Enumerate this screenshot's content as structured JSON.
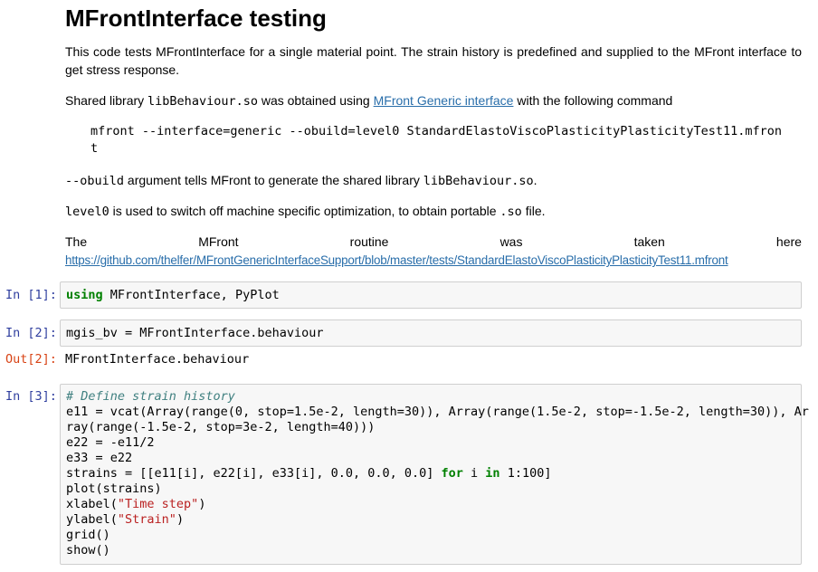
{
  "title": "MFrontInterface testing",
  "intro": {
    "p1": "This code tests MFrontInterface for a single material point. The strain history is predefined and supplied to the MFront interface to get stress response.",
    "p2_before": "Shared library ",
    "p2_code": "libBehaviour.so",
    "p2_mid": " was obtained using ",
    "p2_link": "MFront Generic interface",
    "p2_after": " with the following command",
    "command_line1": "mfront --interface=generic --obuild=level0 StandardElastoViscoPlasticityPlasticityTest11.mfron",
    "command_line2": "t",
    "p3_code": "--obuild",
    "p3_mid": " argument tells MFront to generate the shared library ",
    "p3_code2": "libBehaviour.so",
    "p3_after": ".",
    "p4_code": "level0",
    "p4_mid": " is used to switch off machine specific optimization, to obtain portable ",
    "p4_code2": ".so",
    "p4_after": " file.",
    "p5_words": [
      "The",
      "MFront",
      "routine",
      "was",
      "taken",
      "here"
    ],
    "p5_link": "https://github.com/thelfer/MFrontGenericInterfaceSupport/blob/master/tests/StandardElastoViscoPlasticityPlasticityTest11.mfront"
  },
  "cells": {
    "c1": {
      "prompt": "In [1]:",
      "kw": "using",
      "rest": " MFrontInterface, PyPlot"
    },
    "c2": {
      "prompt": "In [2]:",
      "code": "mgis_bv = MFrontInterface.behaviour",
      "out_prompt": "Out[2]:",
      "output": "MFrontInterface.behaviour"
    },
    "c3": {
      "prompt": "In [3]:",
      "comment": "# Define strain history",
      "l2": "e11 = vcat(Array(range(0, stop=1.5e-2, length=30)), Array(range(1.5e-2, stop=-1.5e-2, length=30)), Ar",
      "l3": "ray(range(-1.5e-2, stop=3e-2, length=40)))",
      "l4": "e22 = -e11/2",
      "l5": "e33 = e22",
      "l6a": "strains = [[e11[i], e22[i], e33[i], 0.0, 0.0, 0.0] ",
      "l6kw1": "for",
      "l6b": " i ",
      "l6kw2": "in",
      "l6c": " 1:100]",
      "l7": "plot(strains)",
      "l8a": "xlabel(",
      "l8s": "\"Time step\"",
      "l8b": ")",
      "l9a": "ylabel(",
      "l9s": "\"Strain\"",
      "l9b": ")",
      "l10": "grid()",
      "l11": "show()"
    }
  }
}
